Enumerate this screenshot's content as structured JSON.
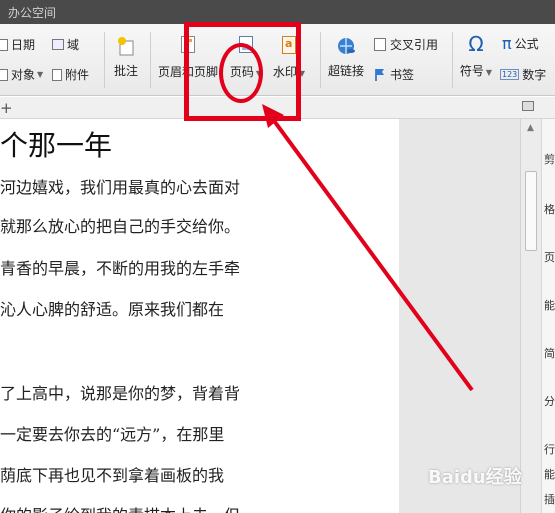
{
  "title_bar": {
    "title": "办公空间"
  },
  "ribbon": {
    "date": "日期",
    "field": "域",
    "object": "对象",
    "attachment": "附件",
    "comment": "批注",
    "header_footer": "页眉和页脚",
    "page_number": "页码",
    "watermark": "水印",
    "hyperlink": "超链接",
    "cross_reference": "交叉引用",
    "bookmark": "书签",
    "symbol": "符号",
    "formula": "公式",
    "number": "数字"
  },
  "document": {
    "heading": "个那一年",
    "lines": [
      "河边嬉戏，我们用最真的心去面对",
      "就那么放心的把自己的手交给你。",
      "青香的早晨，不断的用我的左手牵",
      "沁人心脾的舒适。原来我们都在",
      "",
      "了上高中，说那是你的梦，背着背",
      "一定要去你去的“远方”，在那里",
      "荫底下再也见不到拿着画板的我",
      "你的影子绘到我的素描本上去。但"
    ]
  },
  "right_pane": [
    "剪",
    "格",
    "页",
    "能",
    "简",
    "分",
    "行",
    "能",
    "插"
  ],
  "watermark_text": "Baidu经验",
  "colors": {
    "annotation_red": "#e2001a",
    "title_bar": "#4a4a4a"
  }
}
